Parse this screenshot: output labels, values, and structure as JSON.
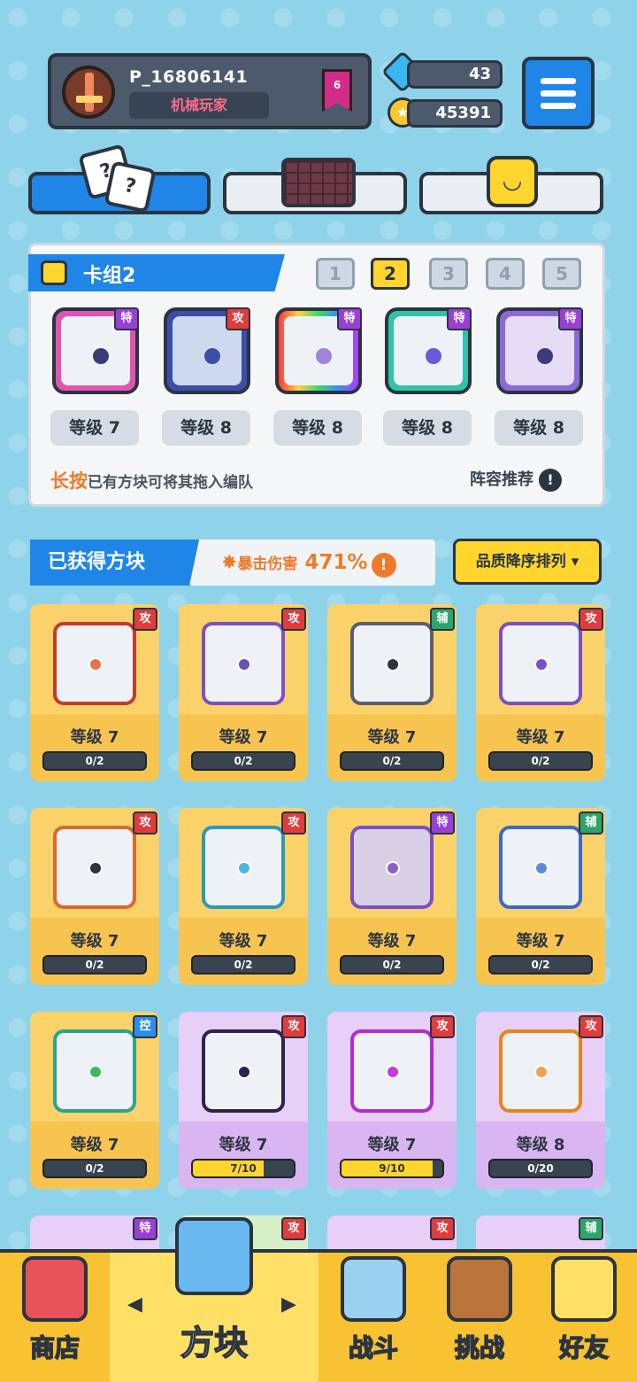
{
  "profile": {
    "name": "P_16806141",
    "title": "机械玩家",
    "rank": "6"
  },
  "currency": {
    "gems": "43",
    "coins": "45391"
  },
  "deck": {
    "title": "卡组2",
    "tabs": [
      "1",
      "2",
      "3",
      "4",
      "5"
    ],
    "active_tab": 1,
    "cards": [
      {
        "tag": "特",
        "level": "等级 7"
      },
      {
        "tag": "攻",
        "level": "等级 8"
      },
      {
        "tag": "特",
        "level": "等级 8"
      },
      {
        "tag": "特",
        "level": "等级 8"
      },
      {
        "tag": "特",
        "level": "等级 8"
      }
    ],
    "hint_em": "长按",
    "hint_rest": "已有方块可将其拖入编队",
    "recommend": "阵容推荐"
  },
  "obtained": {
    "title": "已获得方块",
    "crit_label": "暴击伤害",
    "crit_value": "471%",
    "sort_label": "品质降序排列"
  },
  "grid": [
    {
      "tag": "攻",
      "level": "等级 7",
      "progress": "0/2"
    },
    {
      "tag": "攻",
      "level": "等级 7",
      "progress": "0/2"
    },
    {
      "tag": "辅",
      "level": "等级 7",
      "progress": "0/2"
    },
    {
      "tag": "攻",
      "level": "等级 7",
      "progress": "0/2"
    },
    {
      "tag": "攻",
      "level": "等级 7",
      "progress": "0/2"
    },
    {
      "tag": "攻",
      "level": "等级 7",
      "progress": "0/2"
    },
    {
      "tag": "特",
      "level": "等级 7",
      "progress": "0/2"
    },
    {
      "tag": "辅",
      "level": "等级 7",
      "progress": "0/2"
    },
    {
      "tag": "控",
      "level": "等级 7",
      "progress": "0/2"
    },
    {
      "tag": "攻",
      "level": "等级 7",
      "progress": "7/10",
      "fill": 0.7
    },
    {
      "tag": "攻",
      "level": "等级 7",
      "progress": "9/10",
      "fill": 0.9
    },
    {
      "tag": "攻",
      "level": "等级 8",
      "progress": "0/20"
    }
  ],
  "peek_tags": [
    "特",
    "攻",
    "攻",
    "辅"
  ],
  "nav": [
    "商店",
    "方块",
    "战斗",
    "挑战",
    "好友"
  ],
  "icons": {
    "gem": "gem-icon",
    "coin": "coin-icon",
    "menu": "menu-icon",
    "dice": "dice-icon",
    "chocolate": "chocolate-icon",
    "smiley": "smiley-block-icon"
  },
  "colors": {
    "primary": "#1f86e8",
    "gold": "#f8c232",
    "attack": "#e23b3b",
    "special": "#9a3ed8",
    "support": "#2aa66b",
    "control": "#2a8ee8"
  }
}
